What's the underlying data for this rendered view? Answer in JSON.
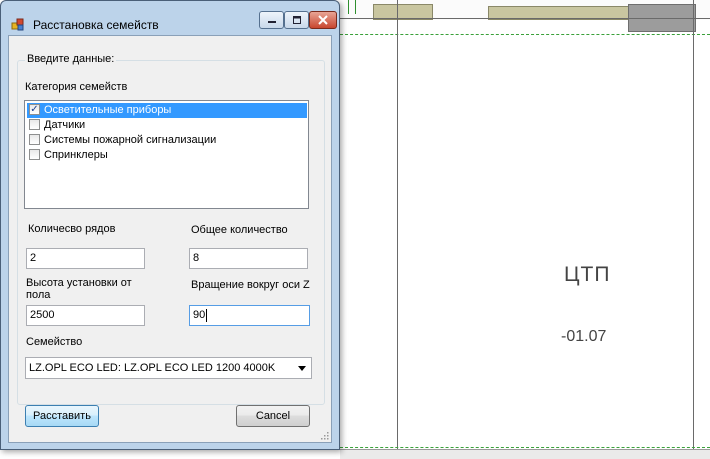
{
  "window": {
    "title": "Расстановка семейств",
    "icon": "app-icon",
    "controls": {
      "minimize_icon": "minimize-icon",
      "maximize_icon": "maximize-icon",
      "close_icon": "close-icon"
    }
  },
  "form": {
    "group_title": "Введите данные:",
    "category_label": "Категория семейств",
    "categories": [
      {
        "label": "Осветительные приборы",
        "checked": true,
        "selected": true
      },
      {
        "label": "Датчики",
        "checked": false,
        "selected": false
      },
      {
        "label": "Системы пожарной сигнализации",
        "checked": false,
        "selected": false
      },
      {
        "label": "Спринклеры",
        "checked": false,
        "selected": false
      }
    ],
    "rows_label": "Количесво рядов",
    "rows_value": "2",
    "total_label": "Общее количество",
    "total_value": "8",
    "height_label_line1": "Высота установки от",
    "height_label_line2": "пола",
    "height_value": "2500",
    "rotation_label": "Вращение вокруг оси Z",
    "rotation_value": "90",
    "family_label": "Семейство",
    "family_value": "LZ.OPL ECO LED: LZ.OPL ECO LED 1200 4000K",
    "place_button": "Расставить",
    "cancel_button": "Cancel"
  },
  "drawing": {
    "room_name": "ЦТП",
    "level": "-01.07"
  },
  "colors": {
    "selection": "#3399ff",
    "titlebar": "#bcd3ea",
    "close_button": "#c8462f"
  }
}
